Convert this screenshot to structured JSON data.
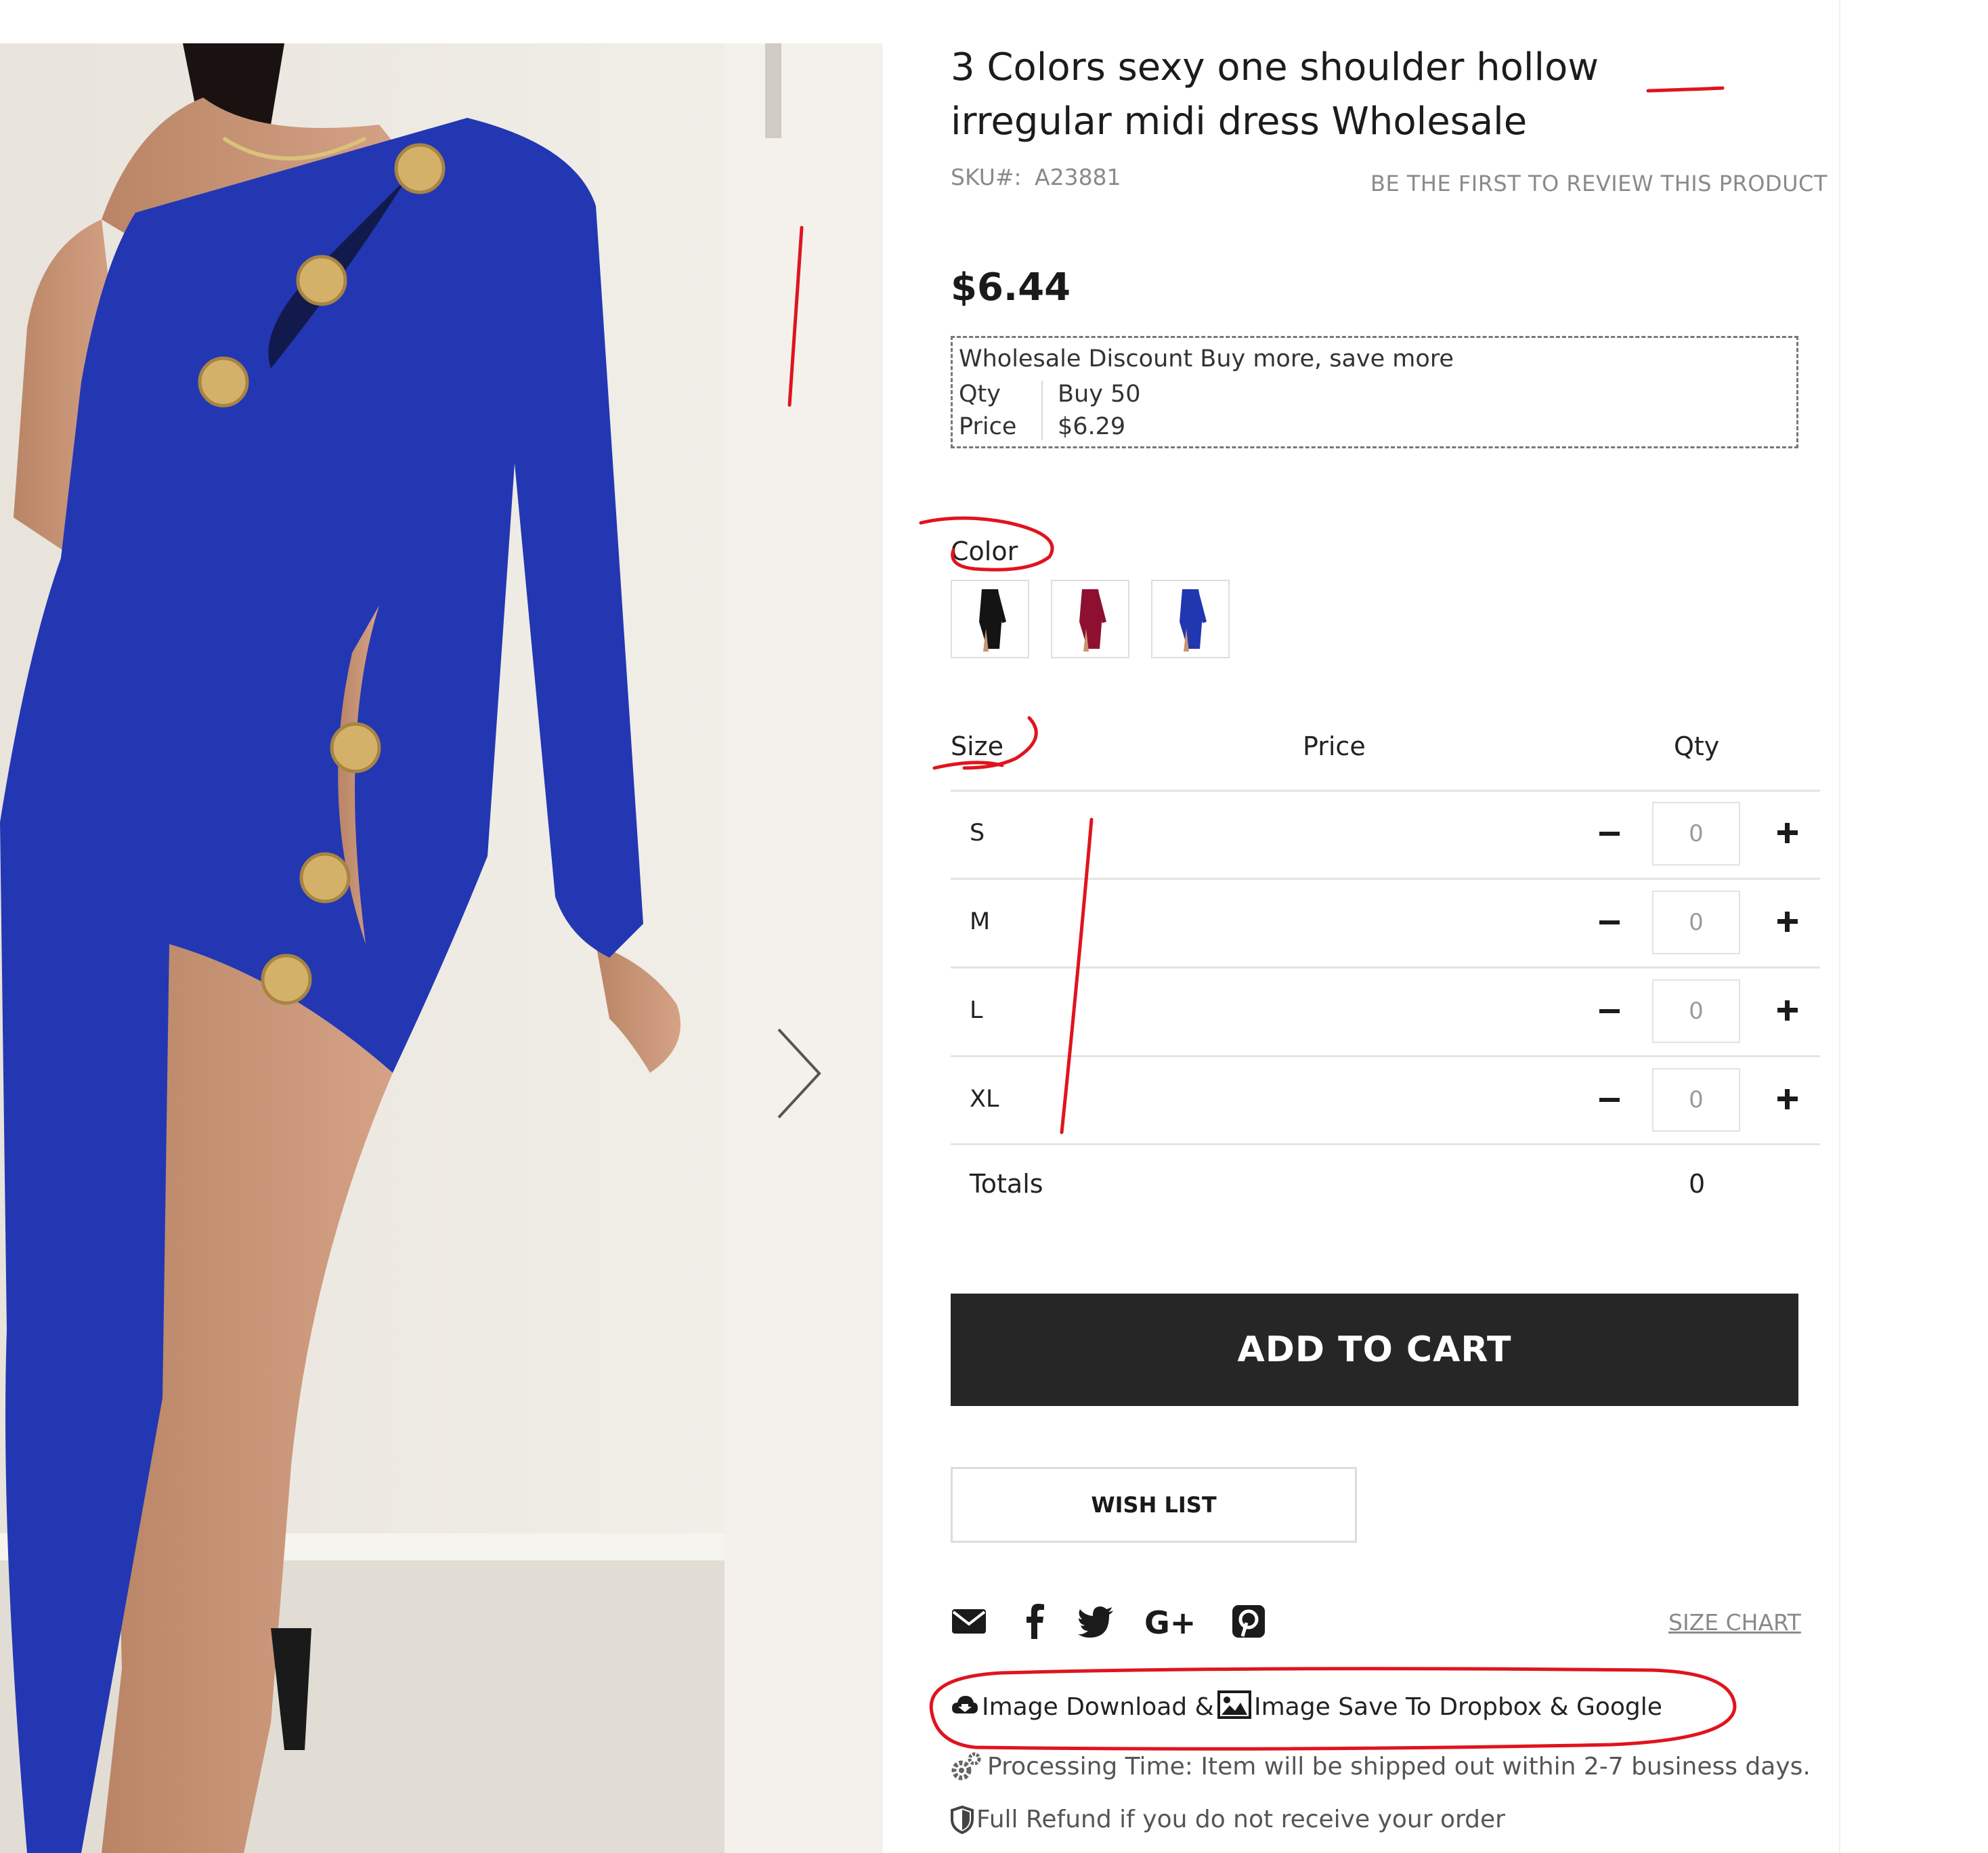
{
  "product": {
    "title": "3 Colors sexy one shoulder hollow irregular midi dress Wholesale",
    "sku_label": "SKU#:",
    "sku": "A23881",
    "review_link": "BE THE FIRST TO REVIEW THIS PRODUCT",
    "price": "$6.44"
  },
  "wholesale": {
    "title": "Wholesale Discount Buy more, save more",
    "qty_label": "Qty",
    "qty_value": "Buy 50",
    "price_label": "Price",
    "price_value": "$6.29"
  },
  "color": {
    "label": "Color",
    "swatches": [
      {
        "name": "black",
        "hex": "#141414"
      },
      {
        "name": "red",
        "hex": "#8e1030"
      },
      {
        "name": "blue",
        "hex": "#2137b0"
      }
    ]
  },
  "size_table": {
    "headers": {
      "size": "Size",
      "price": "Price",
      "qty": "Qty"
    },
    "rows": [
      {
        "size": "S",
        "qty": "0"
      },
      {
        "size": "M",
        "qty": "0"
      },
      {
        "size": "L",
        "qty": "0"
      },
      {
        "size": "XL",
        "qty": "0"
      }
    ],
    "totals_label": "Totals",
    "totals_value": "0"
  },
  "actions": {
    "add_to_cart": "ADD TO CART",
    "wish_list": "WISH LIST",
    "size_chart": "SIZE CHART"
  },
  "share_icons": [
    "email-icon",
    "facebook-icon",
    "twitter-icon",
    "google-plus-icon",
    "pinterest-icon"
  ],
  "downloads": {
    "image_download": "Image Download &",
    "image_save": "Image Save To Dropbox & Google"
  },
  "info": {
    "processing_time": "Processing Time: Item will be shipped out within 2-7 business days.",
    "refund": "Full Refund if you do not receive your order"
  },
  "colors": {
    "dress_blue": "#2337b3",
    "dark_button": "#262626",
    "annotation_red": "#e0141e"
  }
}
